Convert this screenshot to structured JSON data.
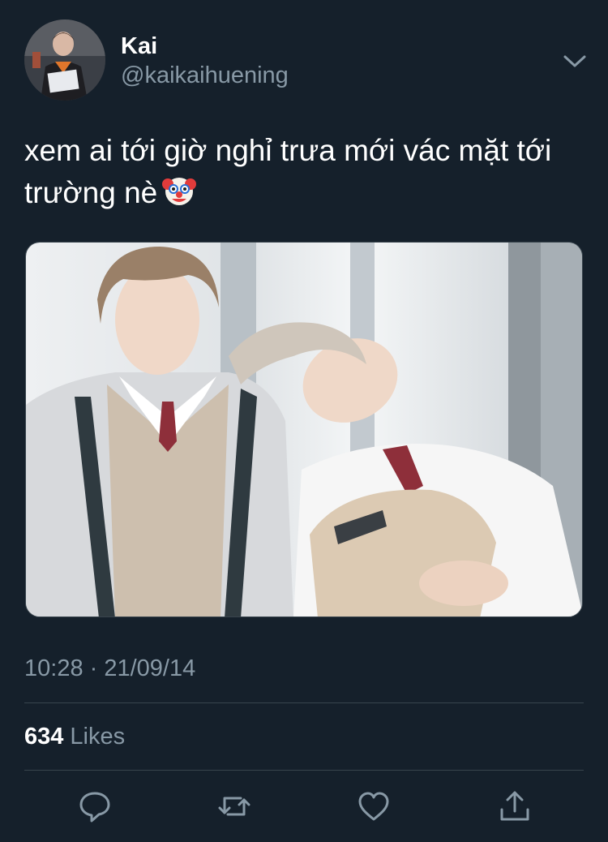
{
  "tweet": {
    "display_name": "Kai",
    "username": "@kaikaihuening",
    "text": "xem ai tới giờ nghỉ trưa mới vác mặt tới trường nè",
    "emoji_icon": "clown-face-icon",
    "timestamp": "10:28 · 21/09/14",
    "likes_count": "634",
    "likes_label": "Likes"
  },
  "actions": [
    {
      "icon": "reply-icon"
    },
    {
      "icon": "retweet-icon"
    },
    {
      "icon": "like-heart-icon"
    },
    {
      "icon": "share-icon"
    }
  ],
  "colors": {
    "background": "#15202b",
    "secondary_text": "#8899a6",
    "divider": "#38444d",
    "primary_text": "#ffffff"
  }
}
